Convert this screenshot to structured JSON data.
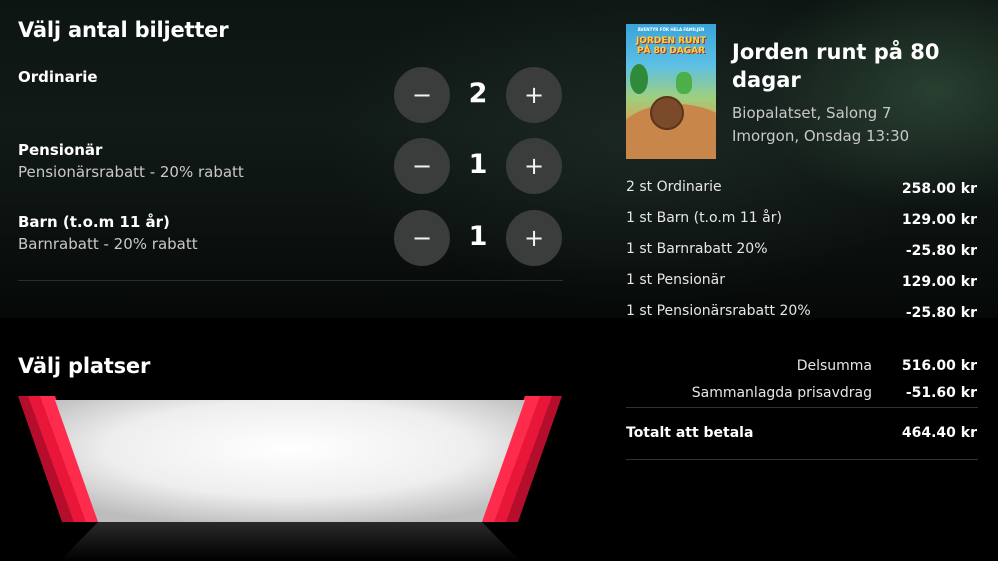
{
  "tickets_section": {
    "title": "Välj antal biljetter",
    "rows": [
      {
        "name": "Ordinarie",
        "sub": "",
        "count": "2",
        "minus": "−",
        "plus": "+"
      },
      {
        "name": "Pensionär",
        "sub": "Pensionärsrabatt - 20% rabatt",
        "count": "1",
        "minus": "−",
        "plus": "+"
      },
      {
        "name": "Barn (t.o.m 11 år)",
        "sub": "Barnrabatt - 20% rabatt",
        "count": "1",
        "minus": "−",
        "plus": "+"
      }
    ]
  },
  "seats_section": {
    "title": "Välj platser"
  },
  "movie": {
    "poster_top": "ÄVENTYR FÖR HELA FAMILJEN",
    "poster_title": "JORDEN RUNT PÅ 80 DAGAR",
    "title": "Jorden runt på 80 dagar",
    "venue": "Biopalatset, Salong 7",
    "time": "Imorgon, Onsdag 13:30"
  },
  "order_lines": [
    {
      "label": "2 st Ordinarie",
      "amount": "258.00 kr"
    },
    {
      "label": "1 st Barn (t.o.m 11 år)",
      "amount": "129.00 kr"
    },
    {
      "label": "1 st Barnrabatt 20%",
      "amount": "-25.80 kr"
    },
    {
      "label": "1 st Pensionär",
      "amount": "129.00 kr"
    },
    {
      "label": "1 st Pensionärsrabatt 20%",
      "amount": "-25.80 kr"
    }
  ],
  "summary": {
    "subtotal_label": "Delsumma",
    "subtotal_amount": "516.00 kr",
    "discount_label": "Sammanlagda prisavdrag",
    "discount_amount": "-51.60 kr",
    "total_label": "Totalt att betala",
    "total_amount": "464.40 kr"
  },
  "colors": {
    "accent_red": "#e8173a",
    "button_bg": "#3b3d3c"
  }
}
